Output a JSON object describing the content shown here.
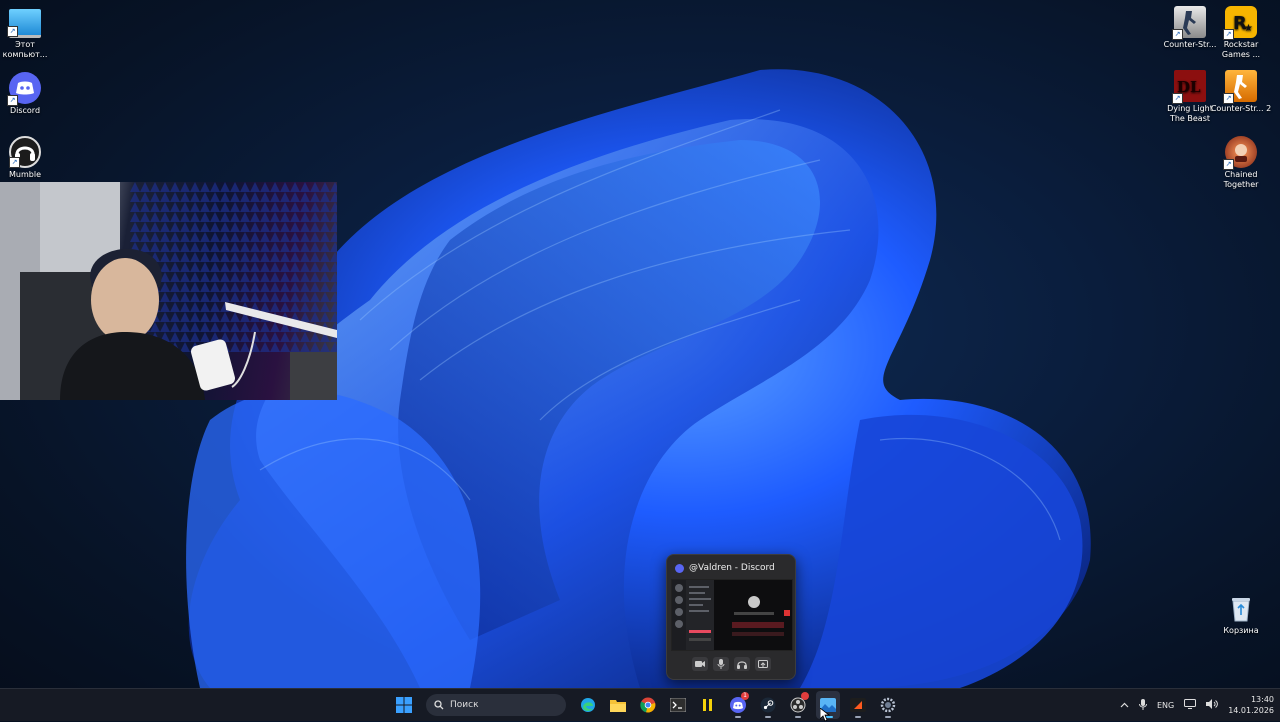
{
  "desktop": {
    "left_icons": [
      {
        "label": "Этот компьют...",
        "icon": "computer-icon"
      },
      {
        "label": "Discord",
        "icon": "discord-icon"
      },
      {
        "label": "Mumble",
        "icon": "mumble-icon"
      }
    ],
    "right_icons": [
      {
        "label": "Counter-Str...",
        "icon": "counter-strike-icon"
      },
      {
        "label": "Rockstar Games ...",
        "icon": "rockstar-icon"
      },
      {
        "label": "Dying Light The Beast",
        "icon": "dying-light-icon"
      },
      {
        "label": "Counter-Str... 2",
        "icon": "counter-strike-2-icon"
      },
      {
        "label": "Chained Together",
        "icon": "chained-together-icon"
      },
      {
        "label": "Корзина",
        "icon": "recycle-bin-icon"
      }
    ]
  },
  "preview": {
    "title": "@Valdren - Discord",
    "controls": [
      "camera-icon",
      "mic-icon",
      "headphones-icon",
      "screen-share-icon"
    ]
  },
  "taskbar": {
    "search_placeholder": "Поиск",
    "apps": [
      "edge-icon",
      "file-explorer-icon",
      "chrome-icon",
      "terminal-icon",
      "app-icon",
      "discord-icon",
      "steam-icon",
      "obs-icon",
      "photos-icon",
      "media-icon",
      "settings-icon"
    ],
    "discord_badge": "1",
    "language": "ENG",
    "time": "13:40",
    "date": "14.01.2026"
  },
  "colors": {
    "wallpaper_blue": "#1f5cff",
    "taskbar_bg": "#161a24",
    "discord_blurple": "#5865f2"
  }
}
